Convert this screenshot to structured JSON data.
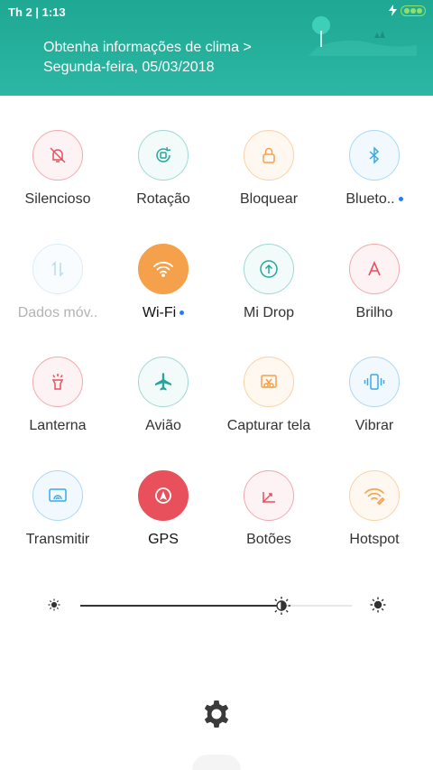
{
  "status": {
    "time": "Th 2 | 1:13"
  },
  "header": {
    "weather_link": "Obtenha informações de clima >",
    "date": "Segunda-feira, 05/03/2018"
  },
  "tiles": [
    {
      "label": "Silencioso",
      "icon": "bell-off-icon",
      "color": "#e8505b",
      "active": false
    },
    {
      "label": "Rotação",
      "icon": "rotation-icon",
      "color": "#26a69a",
      "active": false
    },
    {
      "label": "Bloquear",
      "icon": "lock-icon",
      "color": "#f5a04a",
      "active": false
    },
    {
      "label": "Blueto..",
      "icon": "bluetooth-icon",
      "color": "#38a9e8",
      "active": false
    },
    {
      "label": "Dados móv..",
      "icon": "mobile-data-icon",
      "color": "#38a9e8",
      "active": false
    },
    {
      "label": "Wi-Fi",
      "icon": "wifi-icon",
      "color": "#f5a04a",
      "active": true
    },
    {
      "label": "Mi Drop",
      "icon": "mi-drop-icon",
      "color": "#26a69a",
      "active": false
    },
    {
      "label": "Brilho",
      "icon": "brightness-auto-icon",
      "color": "#e8505b",
      "active": false
    },
    {
      "label": "Lanterna",
      "icon": "flashlight-icon",
      "color": "#e8505b",
      "active": false
    },
    {
      "label": "Avião",
      "icon": "airplane-icon",
      "color": "#26a69a",
      "active": false
    },
    {
      "label": "Capturar tela",
      "icon": "screenshot-icon",
      "color": "#f5a04a",
      "active": false
    },
    {
      "label": "Vibrar",
      "icon": "vibrate-icon",
      "color": "#38a9e8",
      "active": false
    },
    {
      "label": "Transmitir",
      "icon": "cast-icon",
      "color": "#38a9e8",
      "active": false
    },
    {
      "label": "GPS",
      "icon": "gps-icon",
      "color": "#e8505b",
      "active": true
    },
    {
      "label": "Botões",
      "icon": "buttons-icon",
      "color": "#e8505b",
      "active": false
    },
    {
      "label": "Hotspot",
      "icon": "hotspot-icon",
      "color": "#f5a04a",
      "active": false
    }
  ],
  "brightness": {
    "level": 0.74
  }
}
